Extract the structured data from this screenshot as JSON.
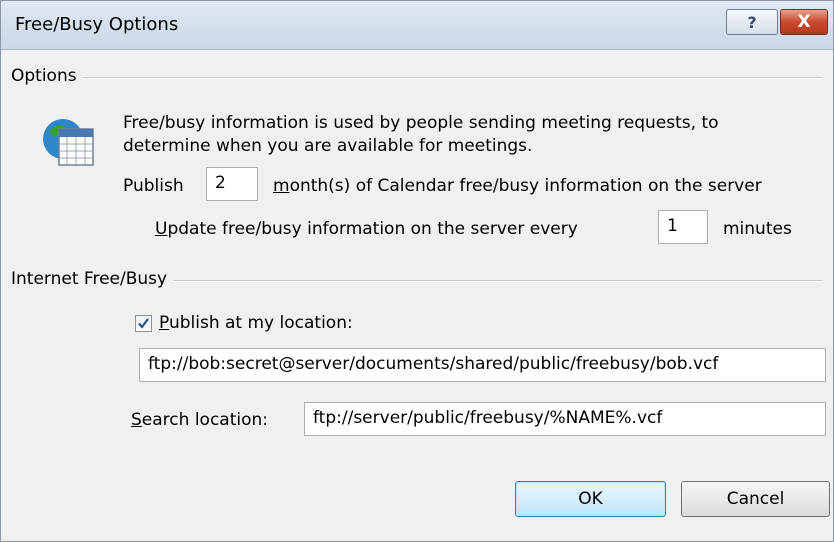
{
  "window": {
    "title": "Free/Busy Options",
    "help_label": "?",
    "close_label": "X"
  },
  "options": {
    "group_label": "Options",
    "icon": "calendar-globe-icon",
    "description_line1": "Free/busy information is used by people sending meeting requests, to",
    "description_line2": "determine when you are available for meetings.",
    "publish_prefix": "Publish",
    "publish_months_value": "2",
    "publish_suffix_mnemonic": "m",
    "publish_suffix_rest": "onth(s) of Calendar free/busy information on the server",
    "update_prefix_mnemonic": "U",
    "update_prefix_rest": "pdate free/busy information on the server every",
    "update_minutes_value": "1",
    "update_suffix": "minutes"
  },
  "internet": {
    "group_label": "Internet Free/Busy",
    "publish_checked": true,
    "publish_label_mnemonic": "P",
    "publish_label_rest": "ublish at my location:",
    "publish_location_value": "ftp://bob:secret@server/documents/shared/public/freebusy/bob.vcf",
    "search_label_mnemonic": "S",
    "search_label_rest": "earch location:",
    "search_location_value": "ftp://server/public/freebusy/%NAME%.vcf"
  },
  "buttons": {
    "ok_label": "OK",
    "cancel_label": "Cancel"
  }
}
